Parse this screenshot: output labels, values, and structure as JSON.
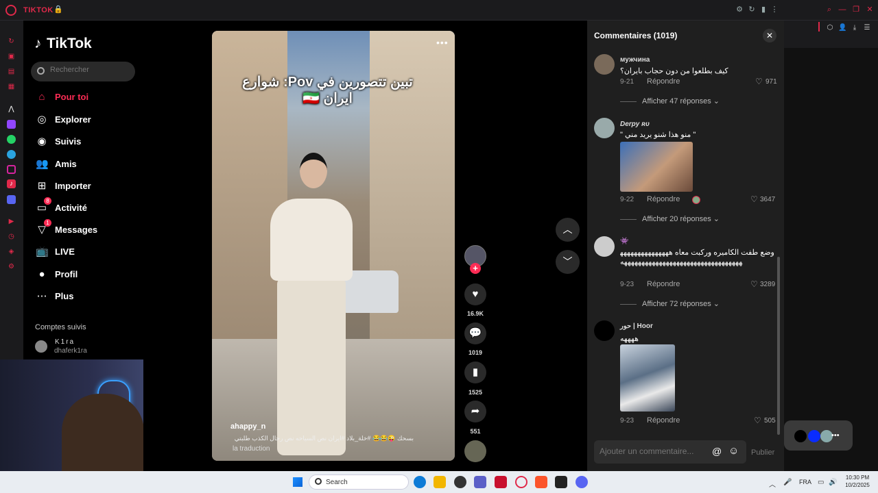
{
  "browser": {
    "tab_title": "TIKTOK",
    "lock_icon": "lock-icon",
    "sidebar_icons": [
      "history-icon",
      "bag-icon",
      "chat-icon",
      "feed-icon",
      "tiktok-alt-icon",
      "twitch-icon",
      "whatsapp-icon",
      "telegram-icon",
      "instagram-icon",
      "tiktok-icon",
      "discord-icon",
      "player-icon",
      "clock-icon",
      "box-icon",
      "settings-icon"
    ]
  },
  "nav": {
    "logo": "TikTok",
    "search_placeholder": "Rechercher",
    "items": [
      {
        "label": "Pour toi",
        "icon": "home-icon",
        "active": true
      },
      {
        "label": "Explorer",
        "icon": "compass-icon"
      },
      {
        "label": "Suivis",
        "icon": "following-icon"
      },
      {
        "label": "Amis",
        "icon": "friends-icon"
      },
      {
        "label": "Importer",
        "icon": "upload-icon"
      },
      {
        "label": "Activité",
        "icon": "activity-icon",
        "badge": "8"
      },
      {
        "label": "Messages",
        "icon": "messages-icon",
        "badge": "1"
      },
      {
        "label": "LIVE",
        "icon": "live-icon"
      },
      {
        "label": "Profil",
        "icon": "profile-icon"
      },
      {
        "label": "Plus",
        "icon": "more-icon"
      }
    ],
    "followed_title": "Comptes suivis",
    "followed": [
      {
        "name": "K1ra",
        "handle": "dhaferk1ra"
      }
    ]
  },
  "video": {
    "caption": "تبين تتصورين في Pov: شوارع ايران 🇮🇷",
    "username": "ahappy_n",
    "description": "بسحك 😜😂😂 #خلة_بلاد #ايران نص السياحه نص رجال الكذب طلبتي",
    "translate": "la traduction",
    "likes": "16.9K",
    "comments": "1019",
    "saves": "1525",
    "shares": "551"
  },
  "comments_panel": {
    "title": "Commentaires (1019)",
    "reply_label": "Répondre",
    "input_placeholder": "Ajouter un commentaire...",
    "publish_label": "Publier",
    "items": [
      {
        "name": "мужчина",
        "text": "كيف بطلعوا من دون حجاب بايران؟",
        "date": "9-21",
        "likes": "971",
        "more": "Afficher 47 réponses"
      },
      {
        "name": "Derpy ʀᴜ",
        "text": "\" منو هذا شنو يريد مني \"",
        "date": "9-22",
        "likes": "3647",
        "more": "Afficher 20 réponses"
      },
      {
        "name": "👾",
        "text": "وضع طفت الكاميره وركبت معاه هههههههههههههههههههههههههههههههههههههههههههههههههه",
        "date": "9-23",
        "likes": "3289",
        "more": "Afficher 72 réponses"
      },
      {
        "name": "حور | Hoor",
        "text": "ههههه",
        "date": "9-23",
        "likes": "505"
      }
    ]
  },
  "taskbar": {
    "search_label": "Search",
    "lang": "FRA",
    "time": "10:30 PM",
    "date": "10/2/2025"
  }
}
